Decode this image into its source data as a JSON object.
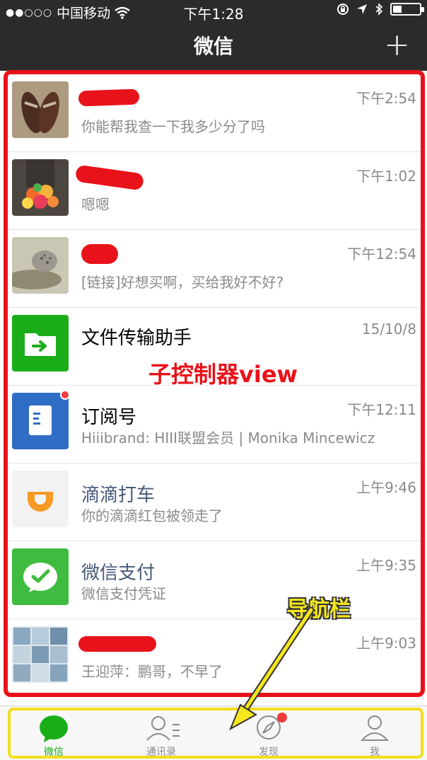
{
  "status_bar": {
    "signal": "●●○○○",
    "carrier": "中国移动",
    "time": "下午1:28"
  },
  "header": {
    "title": "微信",
    "add_symbol": "+"
  },
  "chats": [
    {
      "name": "",
      "preview": "你能帮我查一下我多少分了吗",
      "time": "下午2:54",
      "redacted": true
    },
    {
      "name": "",
      "preview": "嗯嗯",
      "time": "下午1:02",
      "redacted": true
    },
    {
      "name": "",
      "preview": "[链接]好想买啊，买给我好不好?",
      "time": "下午12:54",
      "redacted": true
    },
    {
      "name": "文件传输助手",
      "preview": "",
      "time": "15/10/8"
    },
    {
      "name": "订阅号",
      "preview": "Hiiibrand: HIII联盟会员 | Monika Mincewicz",
      "time": "下午12:11",
      "badge": true
    },
    {
      "name": "滴滴打车",
      "preview": "你的滴滴红包被领走了",
      "time": "上午9:46"
    },
    {
      "name": "微信支付",
      "preview": "微信支付凭证",
      "time": "上午9:35"
    },
    {
      "name": "",
      "preview": "王迎萍：鹏哥，不早了",
      "time": "上午9:03",
      "redacted": true
    }
  ],
  "annotations": {
    "content_label": "子控制器view",
    "nav_label": "导航栏",
    "content_color": "#e8121a",
    "nav_color": "#f1de1c"
  },
  "tabs": [
    {
      "label": "微信",
      "icon": "chat-bubble-icon",
      "active": true
    },
    {
      "label": "通讯录",
      "icon": "contacts-icon"
    },
    {
      "label": "发现",
      "icon": "compass-icon",
      "badge": true
    },
    {
      "label": "我",
      "icon": "person-icon"
    }
  ],
  "colors": {
    "wechat_green": "#1aad19",
    "nav_background": "#2b2b2d",
    "badge_red": "#f23b3b"
  }
}
